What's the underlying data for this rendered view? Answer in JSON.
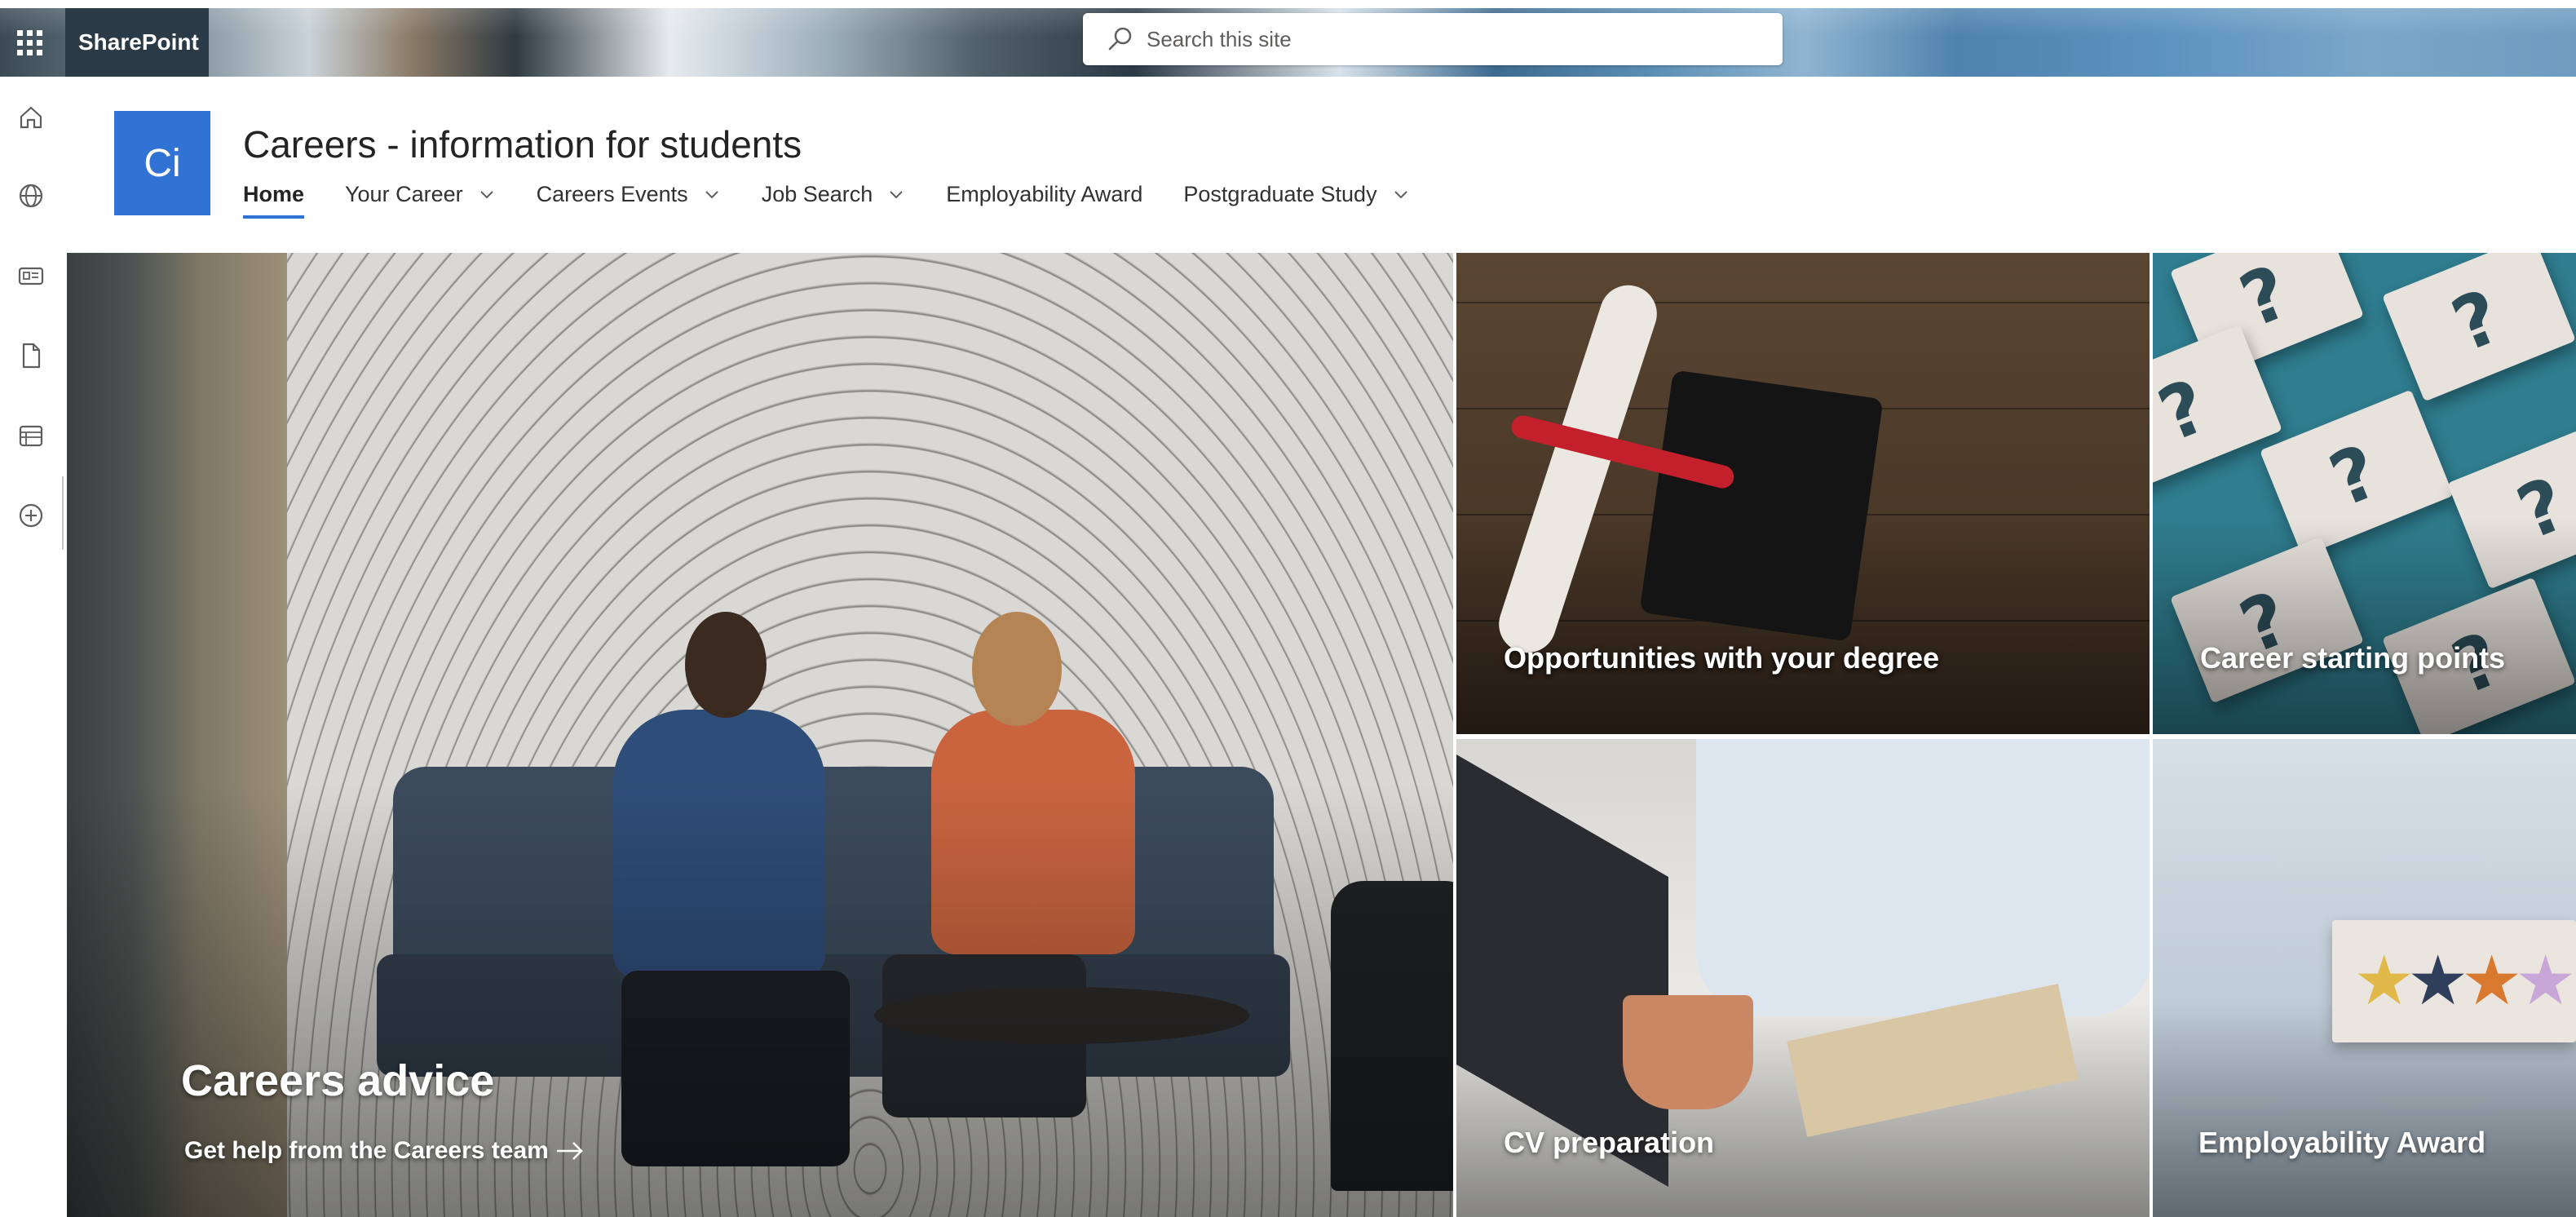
{
  "suitebar": {
    "app_name": "SharePoint",
    "search_placeholder": "Search this site"
  },
  "appbar": {
    "items": [
      {
        "icon": "home-icon"
      },
      {
        "icon": "globe-icon"
      },
      {
        "icon": "news-icon"
      },
      {
        "icon": "file-icon"
      },
      {
        "icon": "list-icon"
      },
      {
        "icon": "add-icon"
      }
    ]
  },
  "site": {
    "logo_initials": "Ci",
    "title": "Careers - information for students",
    "nav": [
      {
        "label": "Home",
        "active": true,
        "has_dropdown": false
      },
      {
        "label": "Your Career",
        "active": false,
        "has_dropdown": true
      },
      {
        "label": "Careers Events",
        "active": false,
        "has_dropdown": true
      },
      {
        "label": "Job Search",
        "active": false,
        "has_dropdown": true
      },
      {
        "label": "Employability Award",
        "active": false,
        "has_dropdown": false
      },
      {
        "label": "Postgraduate Study",
        "active": false,
        "has_dropdown": true
      }
    ]
  },
  "hero": {
    "main": {
      "title": "Careers advice",
      "link_text": "Get help from the Careers team"
    },
    "tiles": [
      {
        "title": "Opportunities with your degree"
      },
      {
        "title": "Career starting points"
      },
      {
        "title": "CV preparation"
      },
      {
        "title": "Employability Award"
      }
    ]
  },
  "colors": {
    "accent": "#3173d5",
    "brand_bar": "#2b3a47"
  }
}
